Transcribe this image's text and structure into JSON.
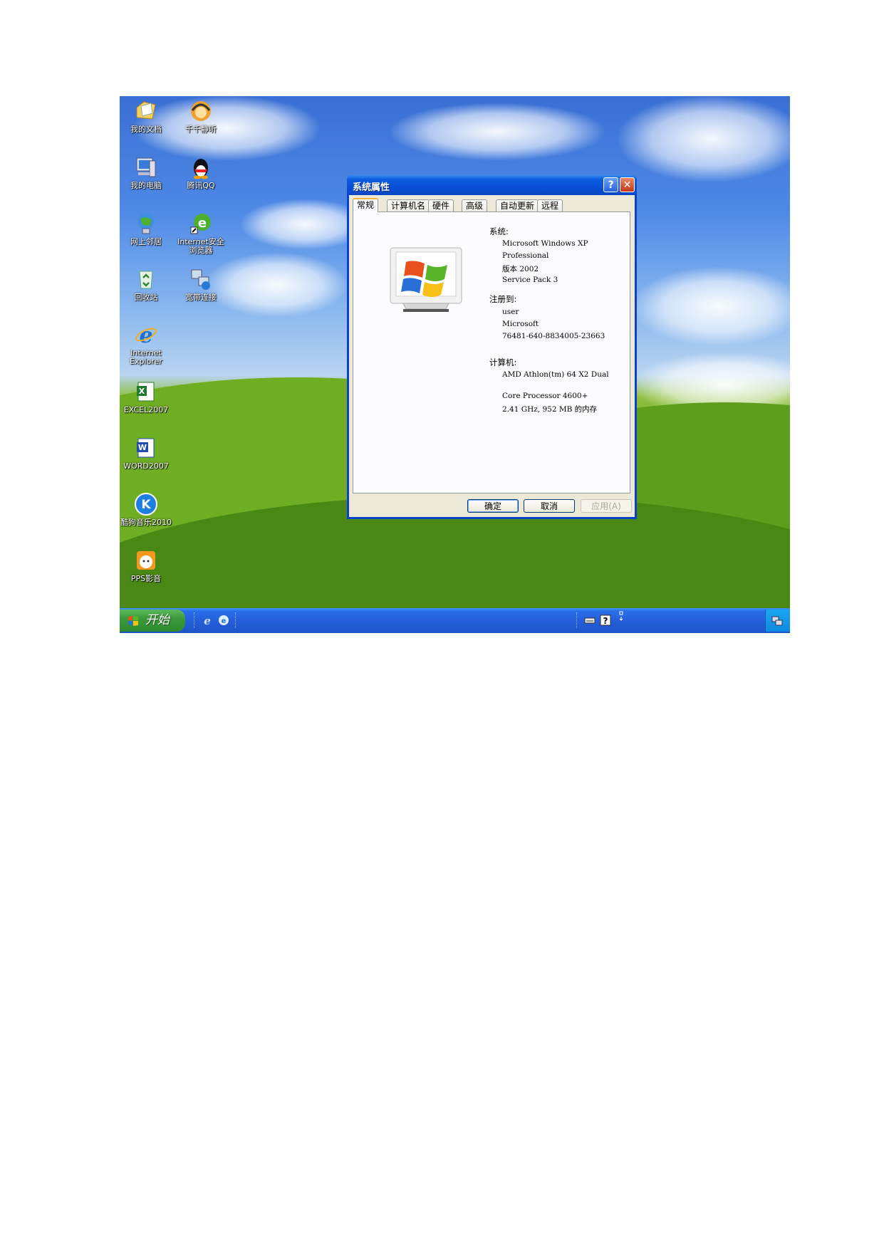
{
  "desktop": {
    "icons": [
      {
        "label": "我的文档",
        "icon": "my-documents-icon"
      },
      {
        "label": "千千静听",
        "icon": "ttplayer-icon"
      },
      {
        "label": "我的电脑",
        "icon": "my-computer-icon"
      },
      {
        "label": "腾讯QQ",
        "icon": "qq-icon"
      },
      {
        "label": "网上邻居",
        "icon": "network-places-icon"
      },
      {
        "label": "Internet安全",
        "label2": "浏览器",
        "icon": "secure-browser-icon"
      },
      {
        "label": "回收站",
        "icon": "recycle-bin-icon"
      },
      {
        "label": "宽带连接",
        "icon": "broadband-connection-icon"
      },
      {
        "label": "Internet",
        "label2": "Explorer",
        "icon": "internet-explorer-icon"
      },
      {
        "label": "EXCEL2007",
        "icon": "excel-icon"
      },
      {
        "label": "WORD2007",
        "icon": "word-icon"
      },
      {
        "label": "酷狗音乐2010",
        "icon": "kugou-icon"
      },
      {
        "label": "PPS影音",
        "icon": "pps-icon"
      }
    ]
  },
  "dialog": {
    "title": "系统属性",
    "help_button": "?",
    "close_button": "✕",
    "tabs": [
      "常规",
      "计算机名",
      "硬件",
      "高级",
      "自动更新",
      "远程"
    ],
    "active_tab": "常规",
    "system_heading": "系统:",
    "system_lines": [
      "Microsoft Windows XP",
      "Professional",
      "版本 2002",
      "Service Pack 3"
    ],
    "registered_heading": "注册到:",
    "registered_lines": [
      "user",
      "Microsoft",
      "76481-640-8834005-23663"
    ],
    "computer_heading": "计算机:",
    "computer_lines": [
      "AMD Athlon(tm) 64 X2 Dual",
      "Core Processor 4600+",
      "2.41 GHz, 952 MB 的内存"
    ],
    "ok_label": "确定",
    "cancel_label": "取消",
    "apply_label": "应用(A)"
  },
  "taskbar": {
    "start_label": "开始",
    "quick_launch": [
      "internet-explorer-icon",
      "browser-icon"
    ],
    "tray_icons": [
      "keyboard-icon",
      "help-icon",
      "arrows-icon"
    ]
  },
  "colors": {
    "dialog_frame": "#0a43c8",
    "dialog_face": "#ece9d8",
    "taskbar": "#245edb",
    "start_button": "#3c9a3c"
  }
}
